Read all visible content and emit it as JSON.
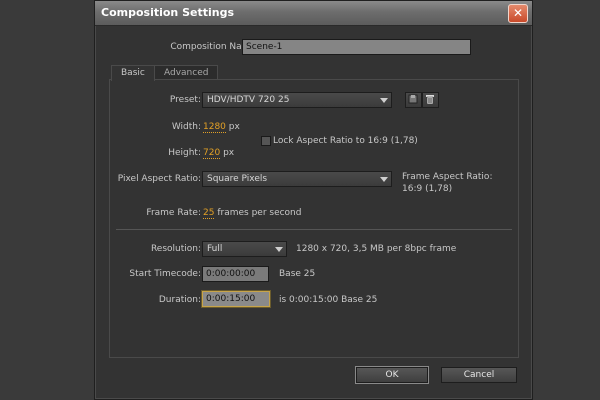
{
  "window": {
    "title": "Composition Settings",
    "close_glyph": "✕"
  },
  "name": {
    "label": "Composition Name:",
    "value": "Scene-1"
  },
  "tabs": [
    {
      "label": "Basic",
      "active": true
    },
    {
      "label": "Advanced",
      "active": false
    }
  ],
  "preset": {
    "label": "Preset:",
    "value": "HDV/HDTV 720 25"
  },
  "width": {
    "label": "Width:",
    "value": "1280",
    "unit": "px"
  },
  "height": {
    "label": "Height:",
    "value": "720",
    "unit": "px"
  },
  "lock_aspect": {
    "label": "Lock Aspect Ratio to 16:9 (1,78)",
    "checked": false
  },
  "pixel_aspect": {
    "label": "Pixel Aspect Ratio:",
    "value": "Square Pixels",
    "frame_aspect_label": "Frame Aspect Ratio:",
    "frame_aspect_value": "16:9 (1,78)"
  },
  "frame_rate": {
    "label": "Frame Rate:",
    "value": "25",
    "unit": "frames per second"
  },
  "resolution": {
    "label": "Resolution:",
    "value": "Full",
    "info": "1280 x 720, 3,5 MB per 8bpc frame"
  },
  "start_timecode": {
    "label": "Start Timecode:",
    "value": "0:00:00:00",
    "base": "Base 25"
  },
  "duration": {
    "label": "Duration:",
    "value": "0:00:15:00",
    "info": "is 0:00:15:00  Base 25"
  },
  "buttons": {
    "ok": "OK",
    "cancel": "Cancel"
  },
  "colors": {
    "accent": "#e3a126",
    "focus": "#c7a449",
    "close": "#c94a2a"
  },
  "icons": [
    "close-icon",
    "dropdown-arrow-icon",
    "save-preset-icon",
    "trash-icon"
  ]
}
